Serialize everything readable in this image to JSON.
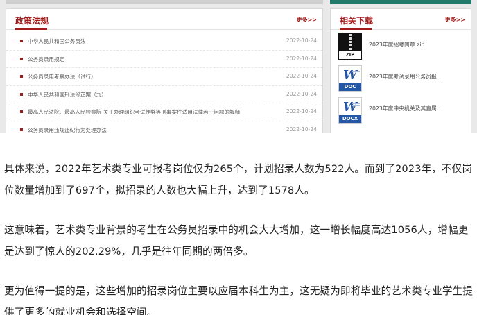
{
  "policy": {
    "title": "政策法规",
    "more": "更多>>",
    "items": [
      {
        "title": "中华人民共和国公务员法",
        "date": "2022-10-24"
      },
      {
        "title": "公务员录用规定",
        "date": "2022-10-24"
      },
      {
        "title": "公务员录用考察办法（试行）",
        "date": "2022-10-24"
      },
      {
        "title": "中华人民共和国刑法修正案（九）",
        "date": "2022-10-24"
      },
      {
        "title": "最高人民法院、最高人民检察院 关于办理组织考试作弊等刑事案件适用法律若干问题的解释",
        "date": "2022-10-24"
      },
      {
        "title": "公务员录用违规违纪行为处理办法",
        "date": "2022-10-24"
      }
    ]
  },
  "downloads": {
    "title": "相关下载",
    "more": "更多>>",
    "items": [
      {
        "name": "2023年度招考简章.zip",
        "ext": "ZIP",
        "icon": "zip-file-icon"
      },
      {
        "name": "2023年度考试录用公务员报...",
        "ext": "DOC",
        "icon": "word-doc-icon"
      },
      {
        "name": "2023年度中央机关及其直属...",
        "ext": "DOCX",
        "icon": "word-docx-icon"
      }
    ]
  },
  "article": {
    "paragraphs": [
      "具体来说，2022年艺术类专业可报考岗位仅为265个，计划招录人数为522人。而到了2023年，不仅岗位数量增加到了697个，拟招录的人数也大幅上升，达到了1578人。",
      "这意味着，艺术类专业背景的考生在公务员招录中的机会大大增加，这一增长幅度高达1056人，增幅更是达到了惊人的202.29%，几乎是往年同期的两倍多。",
      "更为值得一提的是，这些增加的招录岗位主要以应届本科生为主，这无疑为即将毕业的艺术类专业学生提供了更多的就业机会和选择空间。"
    ]
  },
  "colors": {
    "accent": "#a31a1a",
    "doc_blue": "#2458a6",
    "text": "#222222"
  }
}
